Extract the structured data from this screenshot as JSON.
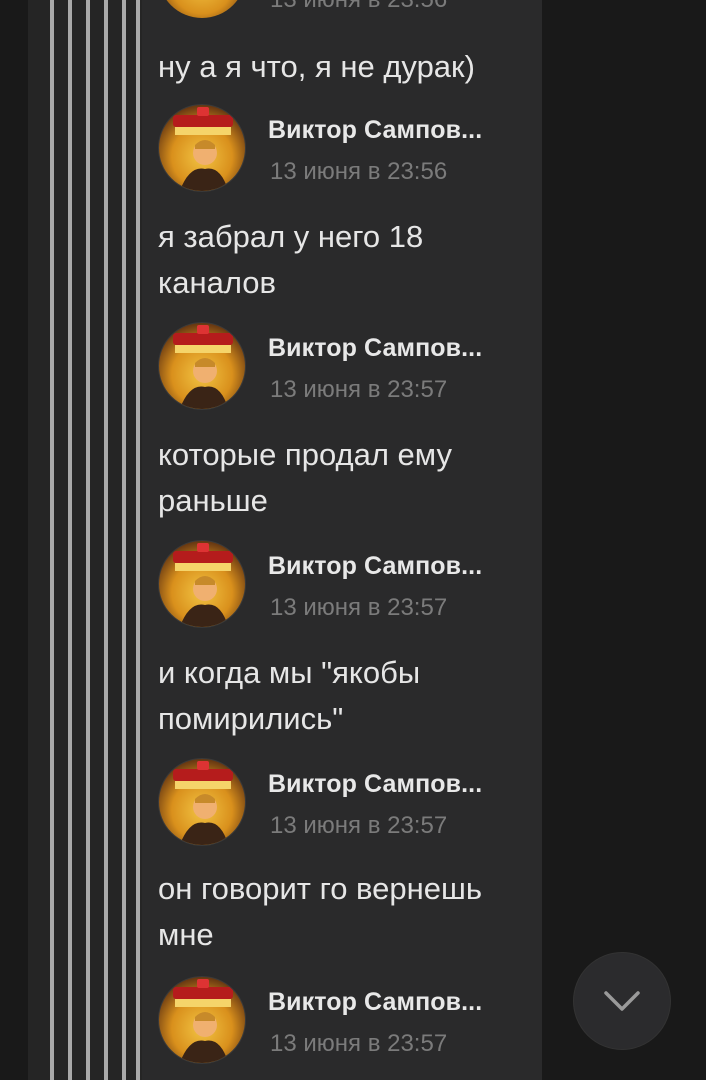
{
  "chat": {
    "partial_top": {
      "time": "13 июня в 23:56"
    },
    "first_message": "ну а я что, я не дурак)",
    "messages": [
      {
        "author": "Виктор Сампов...",
        "time": "13 июня в 23:56",
        "text": "я забрал у него 18 каналов"
      },
      {
        "author": "Виктор Сампов...",
        "time": "13 июня в 23:57",
        "text": "которые продал ему раньше"
      },
      {
        "author": "Виктор Сампов...",
        "time": "13 июня в 23:57",
        "text": "и когда мы \"якобы помирились\""
      },
      {
        "author": "Виктор Сампов...",
        "time": "13 июня в 23:57",
        "text": "он говорит го вернешь мне"
      },
      {
        "author": "Виктор Сампов...",
        "time": "13 июня в 23:57",
        "text": ""
      }
    ]
  },
  "controls": {
    "scroll_down_icon": "chevron-down-icon"
  },
  "colors": {
    "panel_bg": "#2a2a2b",
    "page_bg": "#191919",
    "author": "#e8e8e8",
    "time": "#7b7b7b",
    "text": "#e6e6e6"
  }
}
